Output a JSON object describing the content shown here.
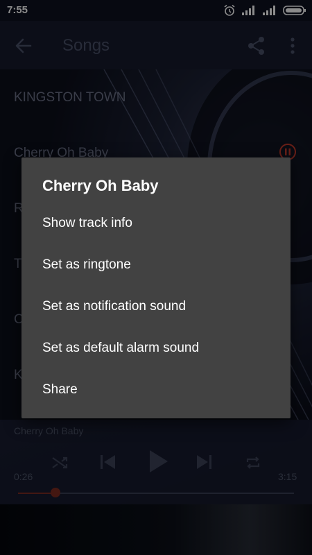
{
  "status_bar": {
    "time": "7:55",
    "icons": [
      "alarm-icon",
      "signal-icon",
      "signal-icon",
      "battery-icon"
    ]
  },
  "toolbar": {
    "title": "Songs",
    "icons": [
      "back-arrow-icon",
      "share-icon",
      "more-vert-icon"
    ]
  },
  "songs": [
    {
      "title": "KINGSTON TOWN"
    },
    {
      "title": "Cherry Oh Baby",
      "playing": true
    },
    {
      "title": "R"
    },
    {
      "title": "T"
    },
    {
      "title": "C"
    },
    {
      "title": "K"
    }
  ],
  "dialog": {
    "title": "Cherry Oh Baby",
    "items": [
      "Show track info",
      "Set as ringtone",
      "Set as notification sound",
      "Set as default alarm sound",
      "Share"
    ]
  },
  "player": {
    "track": "Cherry Oh Baby",
    "elapsed": "0:26",
    "total": "3:15",
    "progress": 0.135,
    "controls": [
      "shuffle-icon",
      "previous-icon",
      "play-icon",
      "next-icon",
      "repeat-icon"
    ]
  },
  "colors": {
    "accent": "#c0392b",
    "dialog_bg": "#424242"
  }
}
